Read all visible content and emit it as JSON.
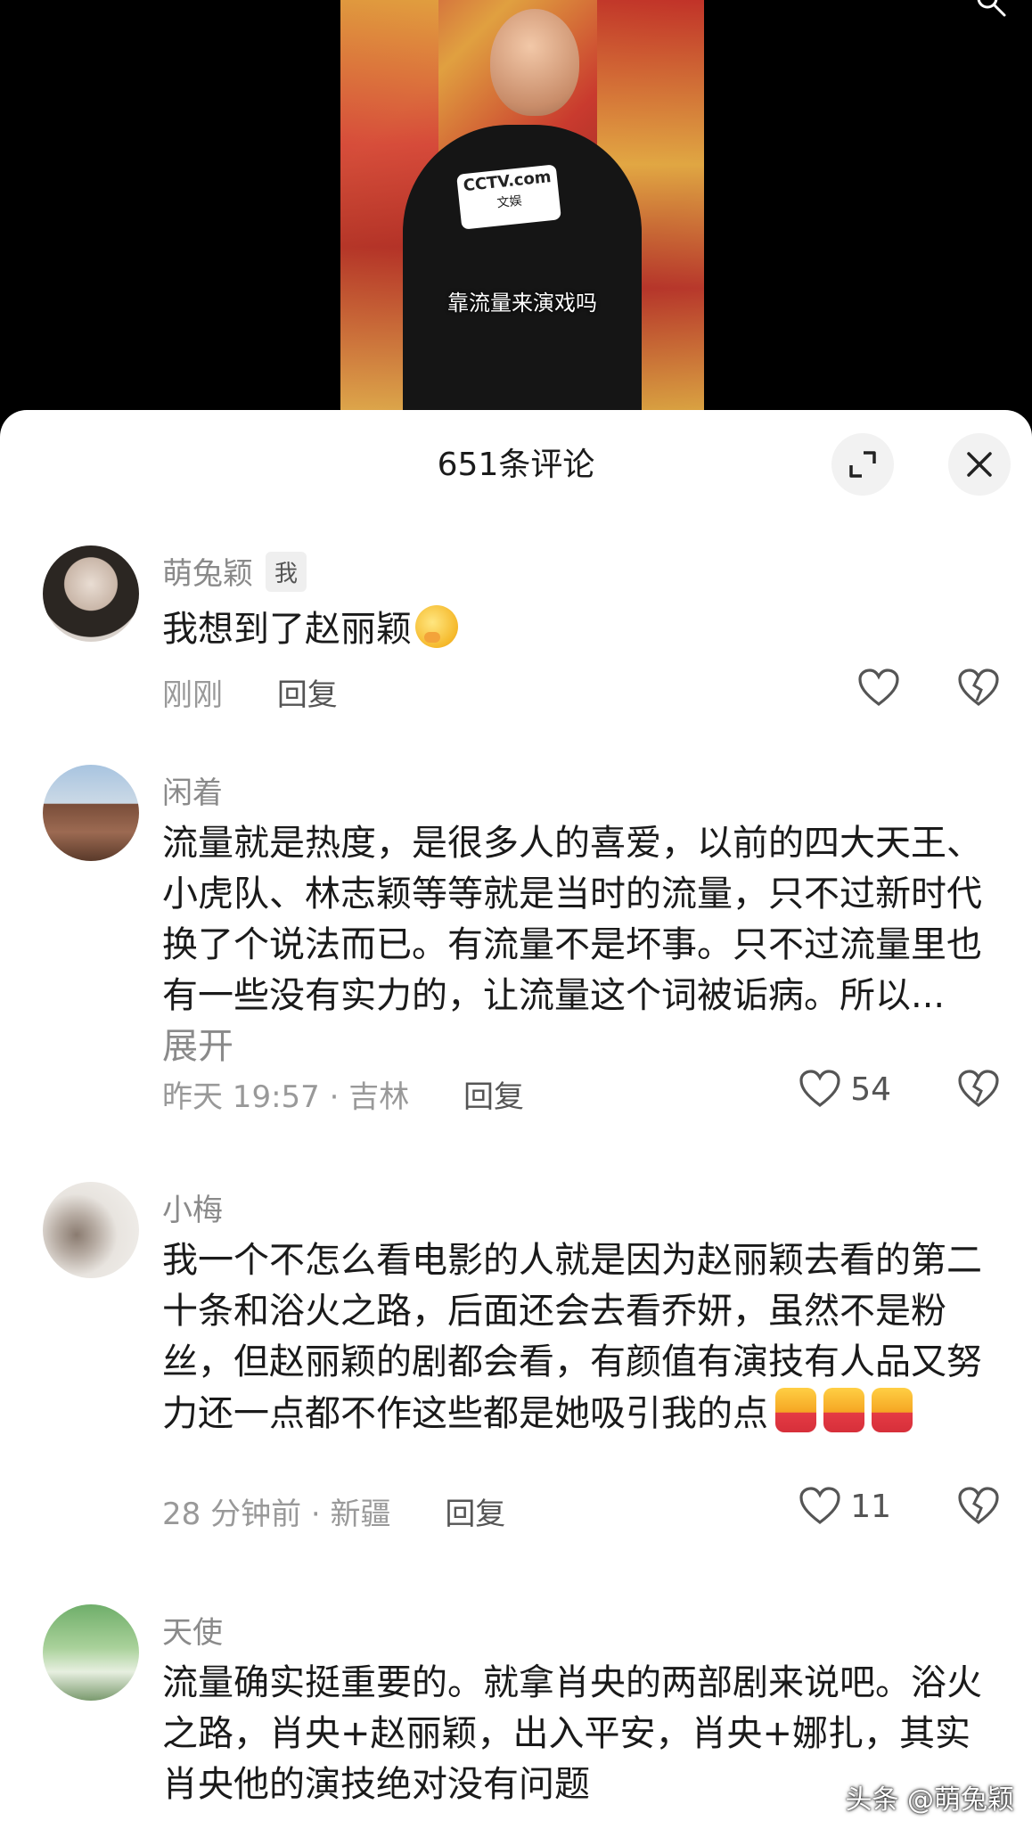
{
  "video": {
    "caption": "靠流量来演戏吗",
    "mic_label": "CCTV.com",
    "mic_sub": "文娱"
  },
  "sheet": {
    "title": "651条评论"
  },
  "comments": [
    {
      "user": "萌兔颖",
      "badge": "我",
      "text": "我想到了赵丽颖",
      "time": "刚刚",
      "reply": "回复",
      "likes": ""
    },
    {
      "user": "闲着",
      "text": "流量就是热度，是很多人的喜爱，以前的四大天王、小虎队、林志颖等等就是当时的流量，只不过新时代换了个说法而已。有流量不是坏事。只不过流量里也有一些没有实力的，让流量这个词被诟病。所以... ",
      "expand": "展开",
      "time": "昨天 19:57 · 吉林",
      "reply": "回复",
      "likes": "54"
    },
    {
      "user": "小梅",
      "text": "我一个不怎么看电影的人就是因为赵丽颖去看的第二十条和浴火之路，后面还会去看乔妍，虽然不是粉丝，但赵丽颖的剧都会看，有颜值有演技有人品又努力还一点都不作这些都是她吸引我的点",
      "time": "28 分钟前 · 新疆",
      "reply": "回复",
      "likes": "11"
    },
    {
      "user": "天使",
      "text": "流量确实挺重要的。就拿肖央的两部剧来说吧。浴火之路，肖央+赵丽颖，出入平安，肖央+娜扎，其实肖央他的演技绝对没有问题",
      "time": "",
      "reply": "",
      "likes": ""
    }
  ],
  "watermark": "头条 @萌兔颖"
}
